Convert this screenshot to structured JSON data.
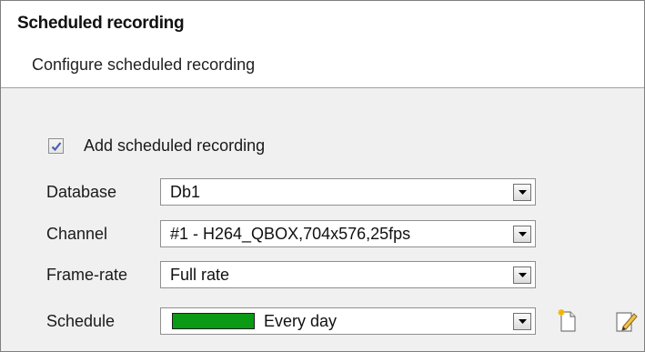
{
  "header": {
    "title": "Scheduled recording",
    "subtitle": "Configure scheduled recording"
  },
  "add_scheduled": {
    "label": "Add scheduled recording",
    "checked": true
  },
  "fields": {
    "database": {
      "label": "Database",
      "value": "Db1"
    },
    "channel": {
      "label": "Channel",
      "value": "#1 - H264_QBOX,704x576,25fps"
    },
    "framerate": {
      "label": "Frame-rate",
      "value": "Full rate"
    },
    "schedule": {
      "label": "Schedule",
      "value": "Every day",
      "swatch_color": "#0a9a14"
    }
  },
  "icons": {
    "new_schedule": "new-document-icon",
    "edit_schedule": "edit-pencil-icon",
    "dropdown": "chevron-down-icon"
  }
}
